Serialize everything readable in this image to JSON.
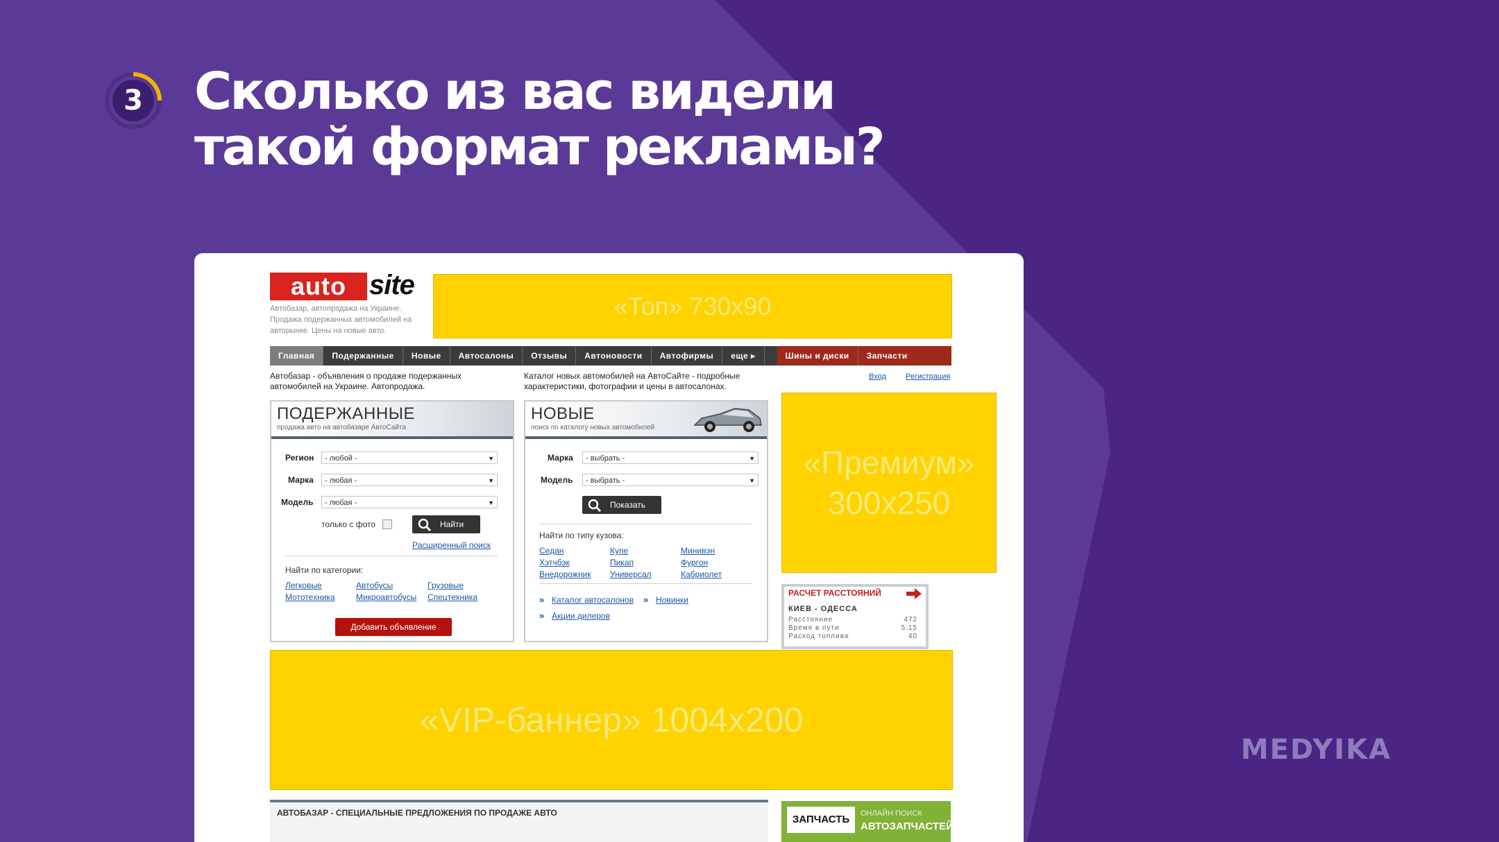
{
  "slide": {
    "step_number": "3",
    "title_line1": "Сколько из вас видели",
    "title_line2": "такой формат рекламы?",
    "brand": "MEDYIKA"
  },
  "site": {
    "logo_auto": "auto",
    "logo_site": "site",
    "logo_desc": "Автобазар, автопродажа на Украине. Продажа подержанных автомобилей на авторынке. Цены на новые авто.",
    "ad_top": "«Топ» 730x90",
    "ad_premium_line1": "«Премиум»",
    "ad_premium_line2": "300x250",
    "ad_vip": "«VIP-баннер» 1004x200",
    "nav": [
      {
        "label": "Главная"
      },
      {
        "label": "Подержанные"
      },
      {
        "label": "Новые"
      },
      {
        "label": "Автосалоны"
      },
      {
        "label": "Отзывы"
      },
      {
        "label": "Автоновости"
      },
      {
        "label": "Автофирмы"
      },
      {
        "label": "еще ▸"
      },
      {
        "label": "Шины и диски"
      },
      {
        "label": "Запчасти"
      }
    ],
    "intro_left_1": "Автобазар - объявления о продаже подержанных",
    "intro_left_2": "автомобилей на Украине. Автопродажа.",
    "intro_right_1": "Каталог новых автомобилей на АвтоСайте - подробные",
    "intro_right_2": "характеристики, фотографии и цены в автосалонах.",
    "login": "Вход",
    "register": "Регистрация",
    "used": {
      "title": "ПОДЕРЖАННЫЕ",
      "subtitle": "продажа авто на автобазаре АвтоСайта",
      "region_label": "Регион",
      "region_value": "- любой -",
      "make_label": "Марка",
      "make_value": "- любая -",
      "model_label": "Модель",
      "model_value": "- любая -",
      "photo_only": "только с фото",
      "search_button": "Найти",
      "advanced_search": "Расширенный поиск",
      "categories_label": "Найти по категории:",
      "categories": [
        "Легковые",
        "Автобусы",
        "Грузовые",
        "Мототехника",
        "Микроавтобусы",
        "Спецтехника"
      ],
      "add_button": "Добавить объявление"
    },
    "new": {
      "title": "НОВЫЕ",
      "subtitle": "поиск по каталогу новых автомобилей",
      "make_label": "Марка",
      "make_value": "- выбрать -",
      "model_label": "Модель",
      "model_value": "- выбрать -",
      "show_button": "Показать",
      "body_type_label": "Найти по типу кузова:",
      "body_types": [
        "Седан",
        "Купе",
        "Минивэн",
        "Хэтчбэк",
        "Пикап",
        "Фургон",
        "Внедорожник",
        "Универсал",
        "Кабриолет"
      ],
      "link_catalog": "Каталог автосалонов",
      "link_new": "Новинки",
      "link_dealers": "Акции дилеров"
    },
    "distance": {
      "title": "РАСЧЕТ РАССТОЯНИЙ",
      "route": "КИЕВ - ОДЕССА",
      "rows": [
        {
          "label": "Расстояние",
          "value": "472"
        },
        {
          "label": "Время в пути",
          "value": "5:15"
        },
        {
          "label": "Расход топлива",
          "value": "40"
        }
      ]
    },
    "offers_title": "АВТОБАЗАР - СПЕЦИАЛЬНЫЕ ПРЕДЛОЖЕНИЯ ПО ПРОДАЖЕ АВТО",
    "zapchast": {
      "logo": "ЗАПЧАСТЬ",
      "line1": "ОНЛАЙН ПОИСК",
      "line2": "АВТОЗАПЧАСТЕЙ"
    }
  },
  "colors": {
    "background": "#5a3a96",
    "ad_yellow": "#ffd200",
    "accent_red": "#d8231f",
    "badge_accent": "#f3b300"
  }
}
